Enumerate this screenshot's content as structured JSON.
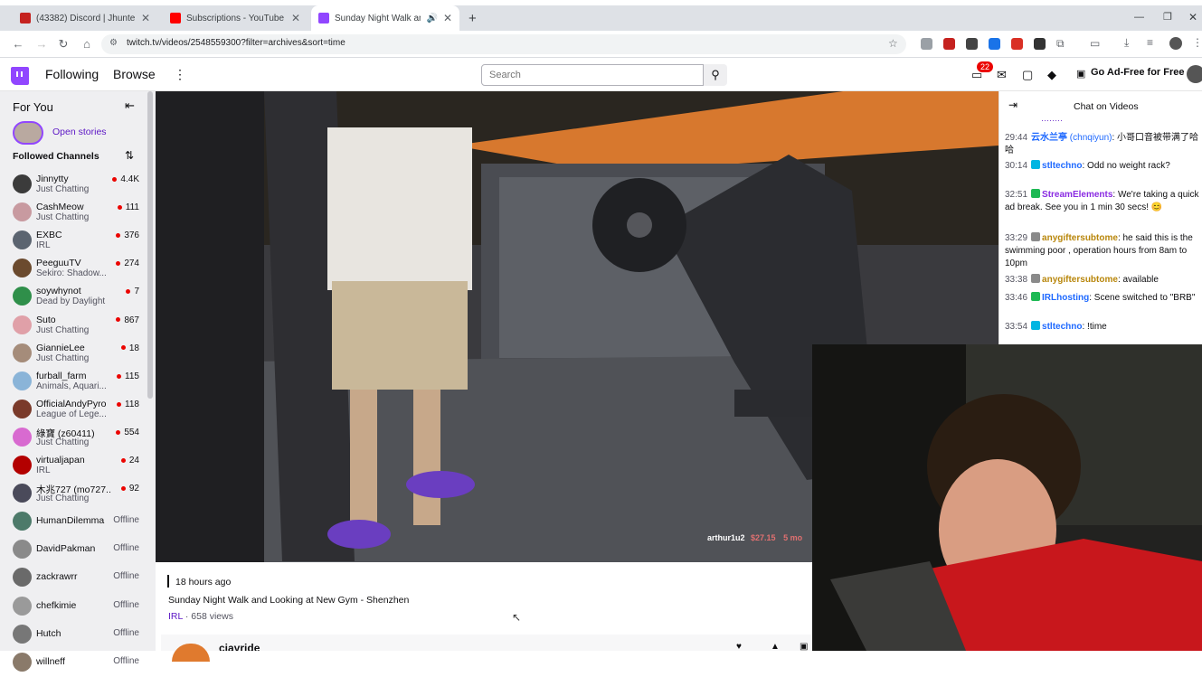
{
  "browser": {
    "tabs": [
      {
        "title": "(43382) Discord | Jhunter, R...",
        "color": "#c5221f",
        "active": false
      },
      {
        "title": "Subscriptions - YouTube",
        "color": "#ff0000",
        "active": false
      },
      {
        "title": "Sunday Night Walk and Lo...",
        "color": "#9146ff",
        "active": true
      }
    ],
    "new_tab": "+",
    "url": "twitch.tv/videos/2548559300?filter=archives&sort=time"
  },
  "header": {
    "following": "Following",
    "browse": "Browse",
    "search_placeholder": "Search",
    "notifications_count": "22",
    "ad_free": "Go Ad-Free for Free"
  },
  "sidebar": {
    "for_you": "For You",
    "open_stories": "Open stories",
    "followed_channels": "Followed Channels",
    "channels": [
      {
        "name": "Jinnytty",
        "game": "Just Chatting",
        "viewers": "4.4K",
        "live": true,
        "color": "#3b3b3b"
      },
      {
        "name": "CashMeow",
        "game": "Just Chatting",
        "viewers": "111",
        "live": true,
        "color": "#c89aa0"
      },
      {
        "name": "EXBC",
        "game": "IRL",
        "viewers": "376",
        "live": true,
        "color": "#5b6470"
      },
      {
        "name": "PeeguuTV",
        "game": "Sekiro: Shadow...",
        "viewers": "274",
        "live": true,
        "color": "#6b4a2e"
      },
      {
        "name": "soywhynot",
        "game": "Dead by Daylight",
        "viewers": "7",
        "live": true,
        "color": "#2f8f4a"
      },
      {
        "name": "Suto",
        "game": "Just Chatting",
        "viewers": "867",
        "live": true,
        "color": "#e0a0a8"
      },
      {
        "name": "GiannieLee",
        "game": "Just Chatting",
        "viewers": "18",
        "live": true,
        "color": "#a58c7a"
      },
      {
        "name": "furball_farm",
        "game": "Animals, Aquari...",
        "viewers": "115",
        "live": true,
        "color": "#8ab4d8"
      },
      {
        "name": "OfficialAndyPyro",
        "game": "League of Lege...",
        "viewers": "118",
        "live": true,
        "color": "#7a3a2a"
      },
      {
        "name": "綠寶 (z60411)",
        "game": "Just Chatting",
        "viewers": "554",
        "live": true,
        "color": "#d86ad0"
      },
      {
        "name": "virtualjapan",
        "game": "IRL",
        "viewers": "24",
        "live": true,
        "color": "#b30000"
      },
      {
        "name": "木兆727 (mo727...",
        "game": "Just Chatting",
        "viewers": "92",
        "live": true,
        "color": "#4a4a5a"
      },
      {
        "name": "HumanDilemma",
        "game": "",
        "viewers": "Offline",
        "live": false,
        "color": "#4d7a6a"
      },
      {
        "name": "DavidPakman",
        "game": "",
        "viewers": "Offline",
        "live": false,
        "color": "#8a8a8a"
      },
      {
        "name": "zackrawrr",
        "game": "",
        "viewers": "Offline",
        "live": false,
        "color": "#6a6a6a"
      },
      {
        "name": "chefkimie",
        "game": "",
        "viewers": "Offline",
        "live": false,
        "color": "#9a9a9a"
      },
      {
        "name": "Hutch",
        "game": "",
        "viewers": "Offline",
        "live": false,
        "color": "#777"
      },
      {
        "name": "willneff",
        "game": "",
        "viewers": "Offline",
        "live": false,
        "color": "#8a7a6a"
      }
    ]
  },
  "video": {
    "watermark": "arthur1u2",
    "watermark_amount": "$27.15",
    "watermark_time": "5 mo"
  },
  "info": {
    "time_ago": "18 hours ago",
    "title": "Sunday Night Walk and Looking at New Gym - Shenzhen",
    "category": "IRL",
    "views": " · 658 views",
    "streamer": "cjayride"
  },
  "chat": {
    "title": "Chat on Videos",
    "messages": [
      {
        "ts": "29:44",
        "user": "云水兰亭",
        "user2": " (chnqiyun)",
        "text": ": 小哥口音被带满了哈哈",
        "color": "#1e69ff",
        "badge": ""
      },
      {
        "ts": "30:14",
        "user": "stltechno",
        "user2": "",
        "text": ": Odd no weight rack?",
        "color": "#1e69ff",
        "badge": "#00b5e2"
      },
      {
        "ts": "32:51",
        "user": "StreamElements",
        "user2": "",
        "text": ": We're taking a quick ad break. See you in 1 min 30 secs! 😊",
        "color": "#8a2be2",
        "badge": "#1db954"
      },
      {
        "ts": "33:29",
        "user": "anygiftersubtome",
        "user2": "",
        "text": ": he said this is the swimming poor , operation hours from 8am to 10pm",
        "color": "#b8860b",
        "badge": ""
      },
      {
        "ts": "33:38",
        "user": "anygiftersubtome",
        "user2": "",
        "text": ": available",
        "color": "#b8860b",
        "badge": ""
      },
      {
        "ts": "33:46",
        "user": "IRLhosting",
        "user2": "",
        "text": ": Scene switched to \"BRB\"",
        "color": "#1e69ff",
        "badge": "#1db954"
      },
      {
        "ts": "33:54",
        "user": "stltechno",
        "user2": "",
        "text": ": !time",
        "color": "#1e69ff",
        "badge": "#00b5e2"
      }
    ]
  }
}
